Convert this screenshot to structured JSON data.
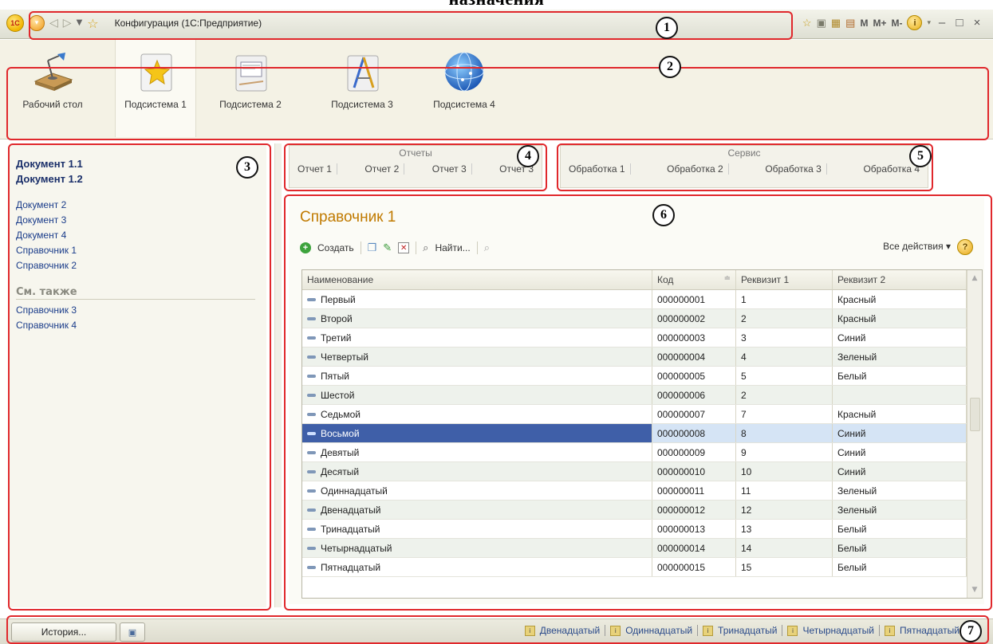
{
  "doc_title": "назначения",
  "window": {
    "logo_text": "1С",
    "title": "Конфигурация (1С:Предприятие)",
    "mem_buttons": [
      "M",
      "M+",
      "M-"
    ],
    "info_label": "i",
    "win_minimize": "–",
    "win_maximize": "□",
    "win_close": "×"
  },
  "sections": [
    {
      "label": "Рабочий стол",
      "icon": "desk-lamp-icon"
    },
    {
      "label": "Подсистема 1",
      "icon": "star-folder-icon",
      "active": true
    },
    {
      "label": "Подсистема 2",
      "icon": "presentation-icon"
    },
    {
      "label": "Подсистема 3",
      "icon": "drawing-tools-icon"
    },
    {
      "label": "Подсистема 4",
      "icon": "globe-icon"
    }
  ],
  "navigation": {
    "important": [
      "Документ 1.1",
      "Документ 1.2"
    ],
    "items": [
      "Документ 2",
      "Документ 3",
      "Документ 4",
      "Справочник 1",
      "Справочник 2"
    ],
    "see_also_title": "См. также",
    "see_also": [
      "Справочник 3",
      "Справочник 4"
    ]
  },
  "reports": {
    "title": "Отчеты",
    "items": [
      "Отчет 1",
      "Отчет 2",
      "Отчет 3",
      "Отчет 3"
    ]
  },
  "service": {
    "title": "Сервис",
    "items": [
      "Обработка 1",
      "Обработка 2",
      "Обработка 3",
      "Обработка 4"
    ]
  },
  "form": {
    "title": "Справочник 1",
    "create_label": "Создать",
    "find_label": "Найти...",
    "all_actions_label": "Все действия ▾",
    "help_label": "?",
    "columns": [
      "Наименование",
      "Код",
      "Реквизит 1",
      "Реквизит 2"
    ],
    "rows": [
      {
        "name": "Первый",
        "code": "000000001",
        "r1": "1",
        "r2": "Красный"
      },
      {
        "name": "Второй",
        "code": "000000002",
        "r1": "2",
        "r2": "Красный"
      },
      {
        "name": "Третий",
        "code": "000000003",
        "r1": "3",
        "r2": "Синий"
      },
      {
        "name": "Четвертый",
        "code": "000000004",
        "r1": "4",
        "r2": "Зеленый"
      },
      {
        "name": "Пятый",
        "code": "000000005",
        "r1": "5",
        "r2": "Белый"
      },
      {
        "name": "Шестой",
        "code": "000000006",
        "r1": "2",
        "r2": ""
      },
      {
        "name": "Седьмой",
        "code": "000000007",
        "r1": "7",
        "r2": "Красный"
      },
      {
        "name": "Восьмой",
        "code": "000000008",
        "r1": "8",
        "r2": "Синий",
        "selected": true
      },
      {
        "name": "Девятый",
        "code": "000000009",
        "r1": "9",
        "r2": "Синий"
      },
      {
        "name": "Десятый",
        "code": "000000010",
        "r1": "10",
        "r2": "Синий"
      },
      {
        "name": "Одиннадцатый",
        "code": "000000011",
        "r1": "11",
        "r2": "Зеленый"
      },
      {
        "name": "Двенадцатый",
        "code": "000000012",
        "r1": "12",
        "r2": "Зеленый"
      },
      {
        "name": "Тринадцатый",
        "code": "000000013",
        "r1": "13",
        "r2": "Белый"
      },
      {
        "name": "Четырнадцатый",
        "code": "000000014",
        "r1": "14",
        "r2": "Белый"
      },
      {
        "name": "Пятнадцатый",
        "code": "000000015",
        "r1": "15",
        "r2": "Белый"
      }
    ]
  },
  "statusbar": {
    "history_label": "История...",
    "open_windows": [
      "Двенадцатый",
      "Одиннадцатый",
      "Тринадцатый",
      "Четырнадцатый",
      "Пятнадцатый"
    ]
  },
  "callouts": [
    "1",
    "2",
    "3",
    "4",
    "5",
    "6",
    "7"
  ],
  "colors": {
    "callout": "#e0282c",
    "form_title": "#c07a00",
    "link": "#1a3c8a",
    "selected_row": "#3f5fa8"
  }
}
